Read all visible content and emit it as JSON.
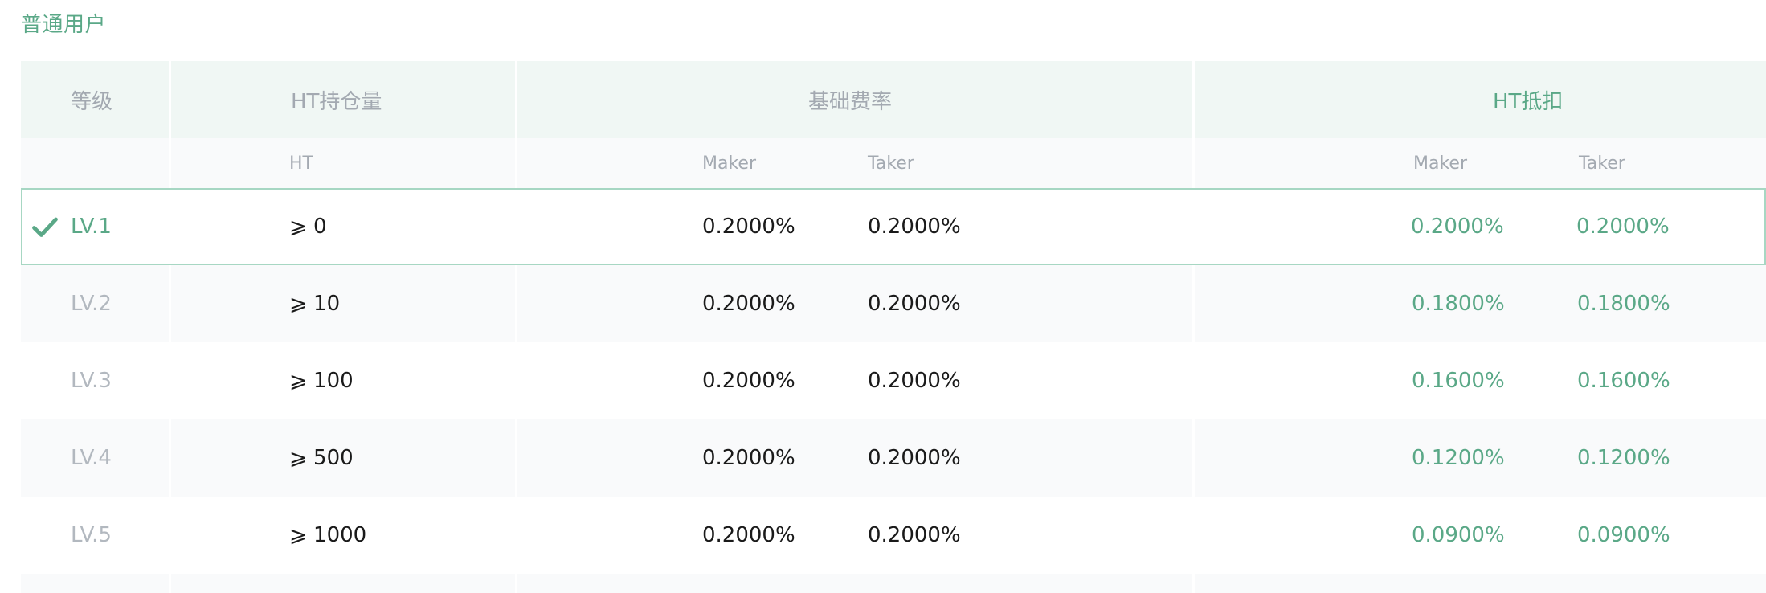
{
  "section_title": "普通用户",
  "header": {
    "level": "等级",
    "ht_holding": "HT持仓量",
    "base_rate": "基础费率",
    "ht_deduction": "HT抵扣",
    "sub_ht": "HT",
    "sub_maker": "Maker",
    "sub_taker": "Taker",
    "sub_maker2": "Maker",
    "sub_taker2": "Taker"
  },
  "colors": {
    "accent": "#5aa887",
    "header_bg": "#f0f7f4",
    "alt_row_bg": "#f9fafb"
  },
  "rows": [
    {
      "level": "LV.1",
      "holding": "⩾ 0",
      "maker": "0.2000%",
      "taker": "0.2000%",
      "ht_maker": "0.2000%",
      "ht_taker": "0.2000%",
      "current": true,
      "icon": "check-icon"
    },
    {
      "level": "LV.2",
      "holding": "⩾ 10",
      "maker": "0.2000%",
      "taker": "0.2000%",
      "ht_maker": "0.1800%",
      "ht_taker": "0.1800%",
      "current": false
    },
    {
      "level": "LV.3",
      "holding": "⩾ 100",
      "maker": "0.2000%",
      "taker": "0.2000%",
      "ht_maker": "0.1600%",
      "ht_taker": "0.1600%",
      "current": false
    },
    {
      "level": "LV.4",
      "holding": "⩾ 500",
      "maker": "0.2000%",
      "taker": "0.2000%",
      "ht_maker": "0.1200%",
      "ht_taker": "0.1200%",
      "current": false
    },
    {
      "level": "LV.5",
      "holding": "⩾ 1000",
      "maker": "0.2000%",
      "taker": "0.2000%",
      "ht_maker": "0.0900%",
      "ht_taker": "0.0900%",
      "current": false
    }
  ]
}
